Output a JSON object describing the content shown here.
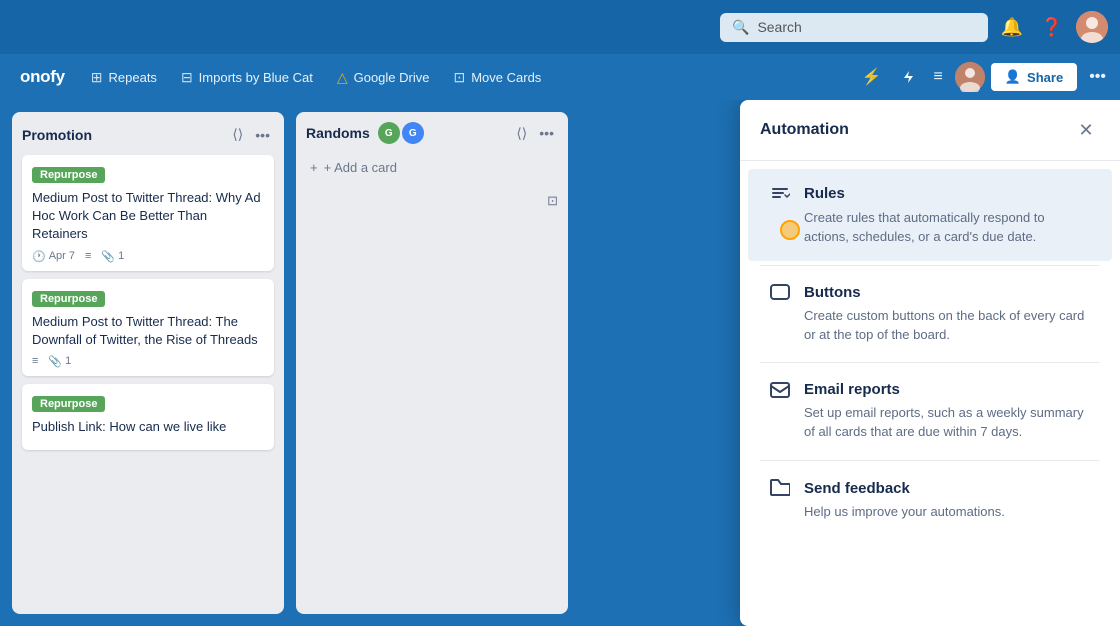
{
  "topbar": {
    "search_placeholder": "Search"
  },
  "navbar": {
    "brand": "onofy",
    "items": [
      {
        "id": "repeats",
        "icon": "⊞",
        "label": "Repeats"
      },
      {
        "id": "imports",
        "icon": "⊟",
        "label": "Imports by Blue Cat"
      },
      {
        "id": "gdrive",
        "icon": "△",
        "label": "Google Drive"
      },
      {
        "id": "movecards",
        "icon": "⊡",
        "label": "Move Cards"
      }
    ],
    "share_label": "Share"
  },
  "lists": [
    {
      "id": "promotion",
      "title": "Promotion",
      "cards": [
        {
          "tag": "Repurpose",
          "title": "Medium Post to Twitter Thread: Why Ad Hoc Work Can Be Better Than Retainers",
          "date": "Apr 7",
          "has_desc": true,
          "attachments": "1"
        },
        {
          "tag": "Repurpose",
          "title": "Medium Post to Twitter Thread: The Downfall of Twitter, the Rise of Threads",
          "date": null,
          "has_desc": true,
          "attachments": "1"
        },
        {
          "tag": "Repurpose",
          "title": "Publish Link: How can we live like",
          "date": null,
          "has_desc": false,
          "attachments": null
        }
      ]
    },
    {
      "id": "randoms",
      "title": "Randoms",
      "avatars": [
        "G",
        "G"
      ],
      "avatar_colors": [
        "#57a55a",
        "#4285f4"
      ],
      "add_card_label": "+ Add a card"
    }
  ],
  "automation": {
    "title": "Automation",
    "items": [
      {
        "id": "rules",
        "icon": "⇄",
        "title": "Rules",
        "description": "Create rules that automatically respond to actions, schedules, or a card's due date.",
        "active": true
      },
      {
        "id": "buttons",
        "icon": "▭",
        "title": "Buttons",
        "description": "Create custom buttons on the back of every card or at the top of the board."
      },
      {
        "id": "email-reports",
        "icon": "✉",
        "title": "Email reports",
        "description": "Set up email reports, such as a weekly summary of all cards that are due within 7 days."
      },
      {
        "id": "send-feedback",
        "icon": "📢",
        "title": "Send feedback",
        "description": "Help us improve your automations."
      }
    ]
  }
}
